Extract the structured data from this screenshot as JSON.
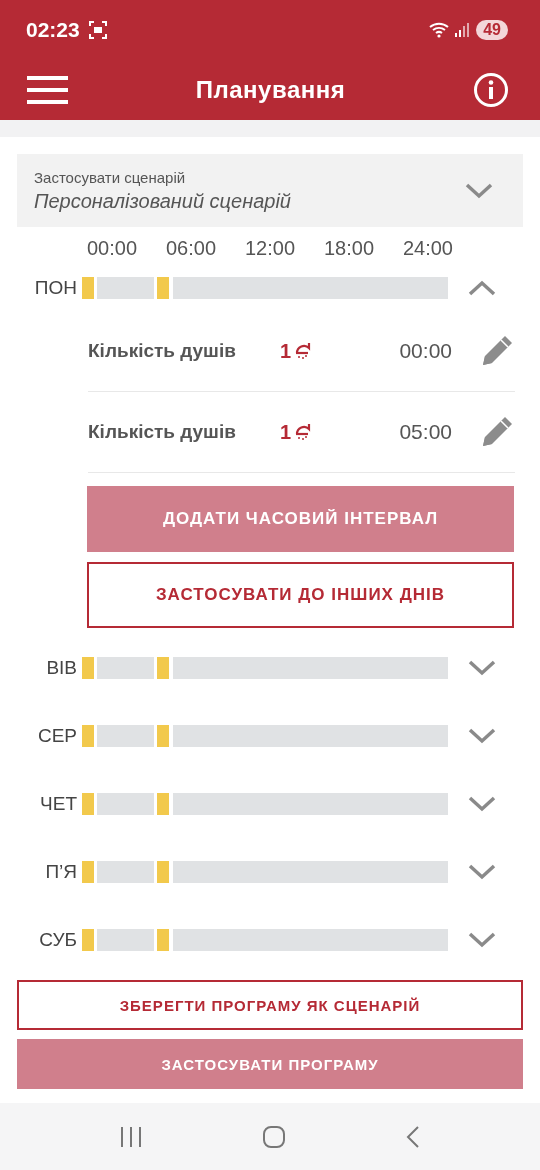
{
  "status_bar": {
    "time": "02:23",
    "battery": "49"
  },
  "app_bar": {
    "title": "Планування"
  },
  "scenario": {
    "label": "Застосувати сценарій",
    "value": "Персоналізований сценарій"
  },
  "time_axis": [
    "00:00",
    "06:00",
    "12:00",
    "18:00",
    "24:00"
  ],
  "days": [
    {
      "label": "ПОН",
      "expanded": true,
      "intervals": [
        {
          "label": "Кількість душів",
          "count": "1",
          "time": "00:00"
        },
        {
          "label": "Кількість душів",
          "count": "1",
          "time": "05:00"
        }
      ],
      "add_button": {
        "label": "ДОДАТИ ЧАСОВИЙ ІНТЕРВАЛ",
        "disabled": true
      },
      "copy_button": {
        "label": "ЗАСТОСУВАТИ ДО ІНШИХ ДНІВ",
        "disabled": false
      }
    },
    {
      "label": "ВІВ",
      "expanded": false
    },
    {
      "label": "СЕР",
      "expanded": false
    },
    {
      "label": "ЧЕТ",
      "expanded": false
    },
    {
      "label": "П’Я",
      "expanded": false
    },
    {
      "label": "СУБ",
      "expanded": false
    }
  ],
  "actions": [
    {
      "label": "ЗБЕРЕГТИ ПРОГРАМУ ЯК СЦЕНАРІЙ",
      "disabled": false
    },
    {
      "label": "ЗАСТОСУВАТИ ПРОГРАМУ",
      "disabled": true
    }
  ]
}
